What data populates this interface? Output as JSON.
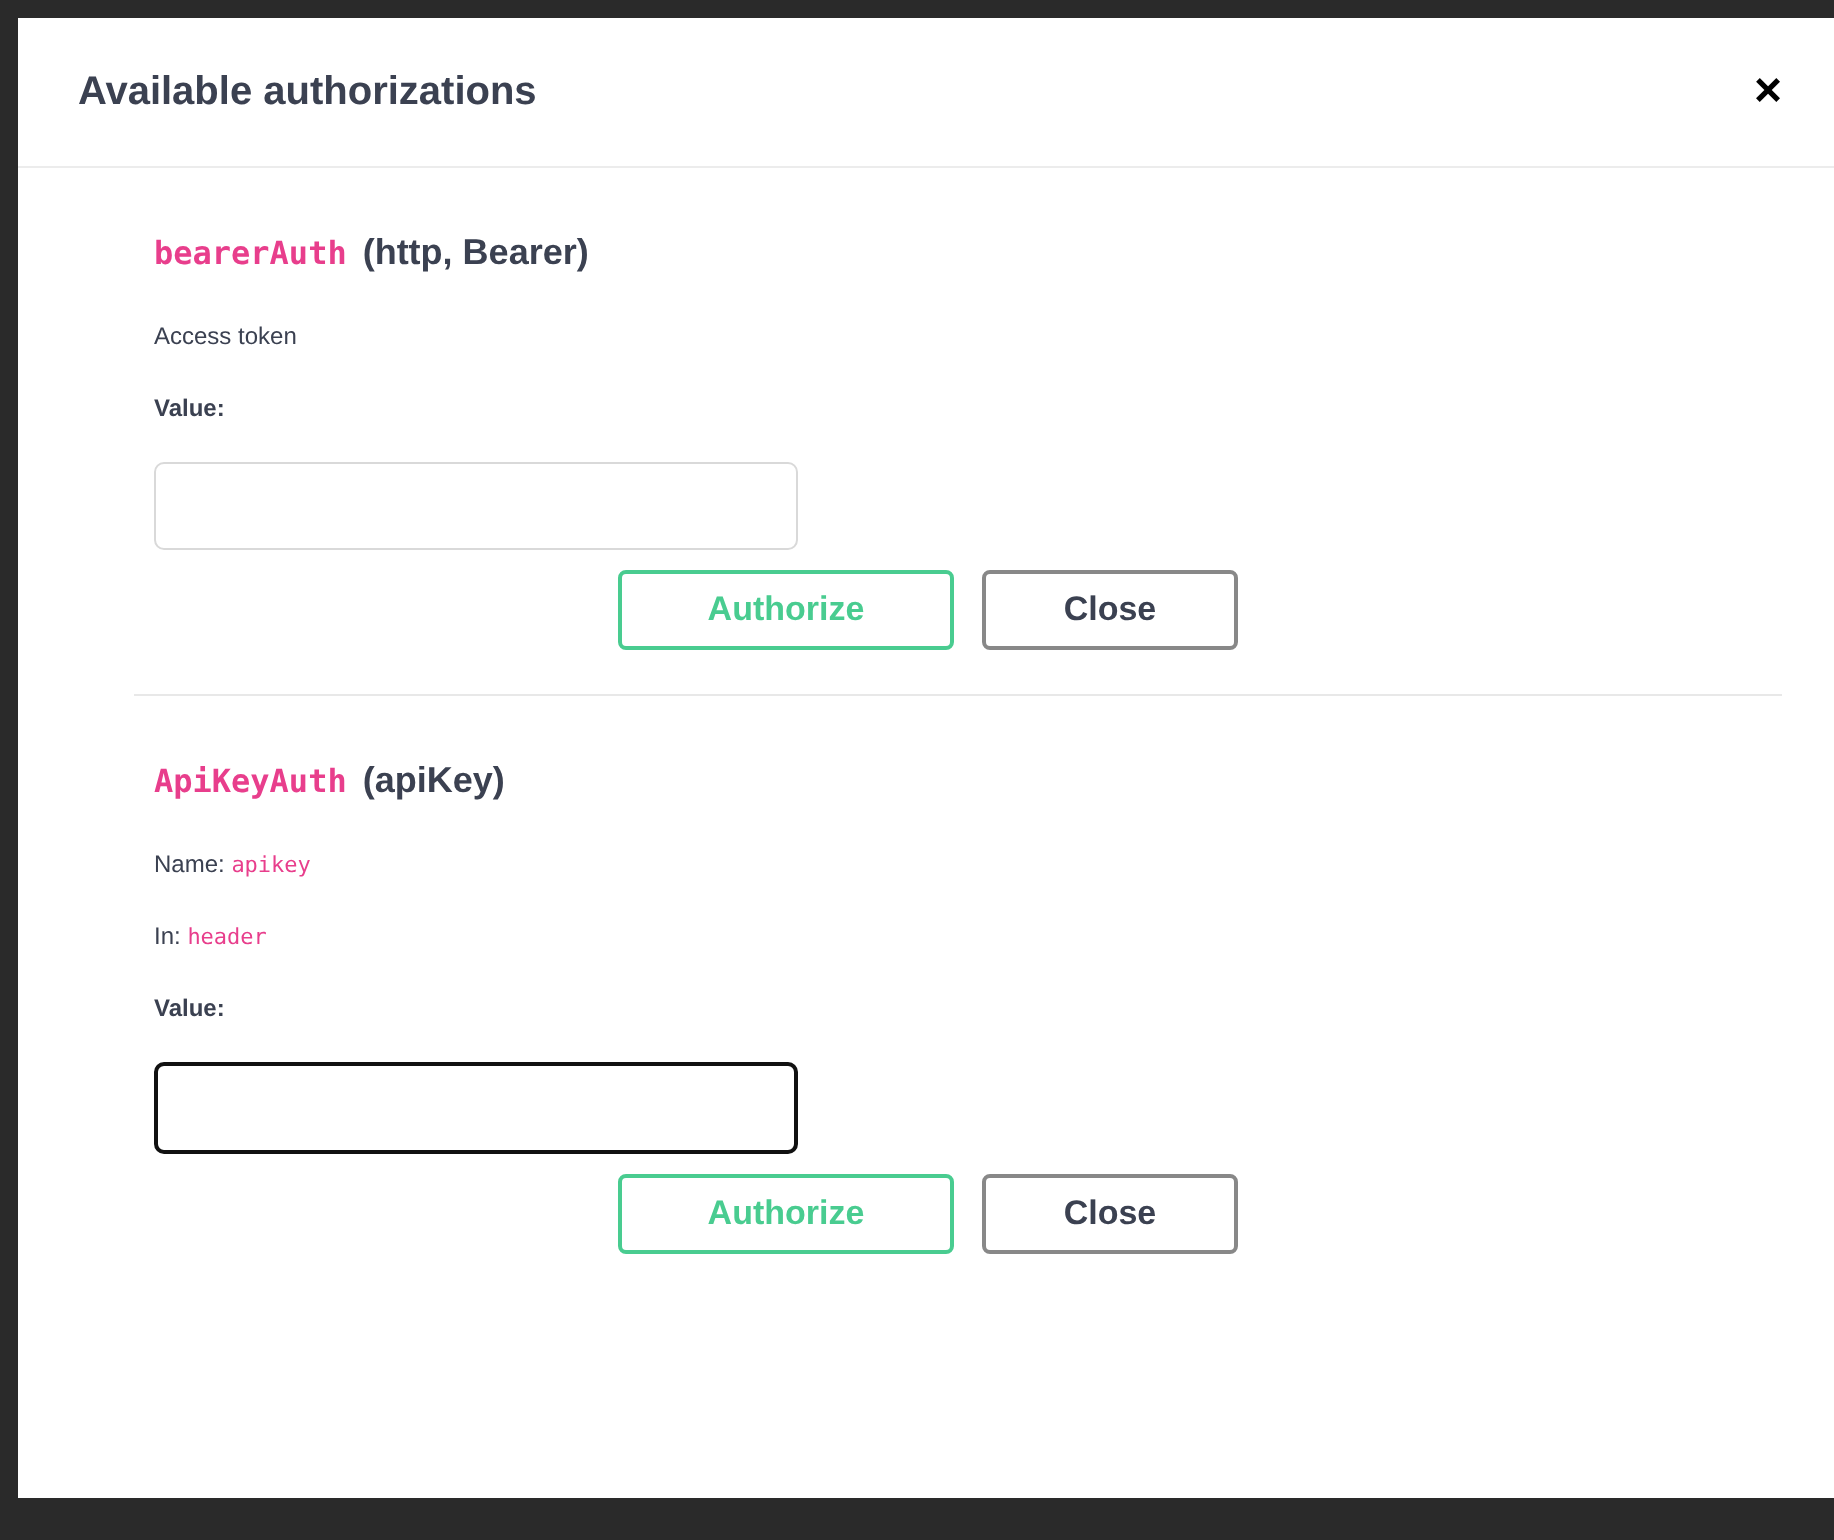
{
  "modal": {
    "title": "Available authorizations",
    "close": "×"
  },
  "schemes": [
    {
      "name": "bearerAuth",
      "type": "(http, Bearer)",
      "description": "Access token",
      "value_label": "Value:",
      "focused": false,
      "buttons": {
        "authorize": "Authorize",
        "close": "Close"
      }
    },
    {
      "name": "ApiKeyAuth",
      "type": "(apiKey)",
      "params": [
        {
          "label": "Name:",
          "value": "apikey"
        },
        {
          "label": "In:",
          "value": "header"
        }
      ],
      "value_label": "Value:",
      "focused": true,
      "buttons": {
        "authorize": "Authorize",
        "close": "Close"
      }
    }
  ]
}
